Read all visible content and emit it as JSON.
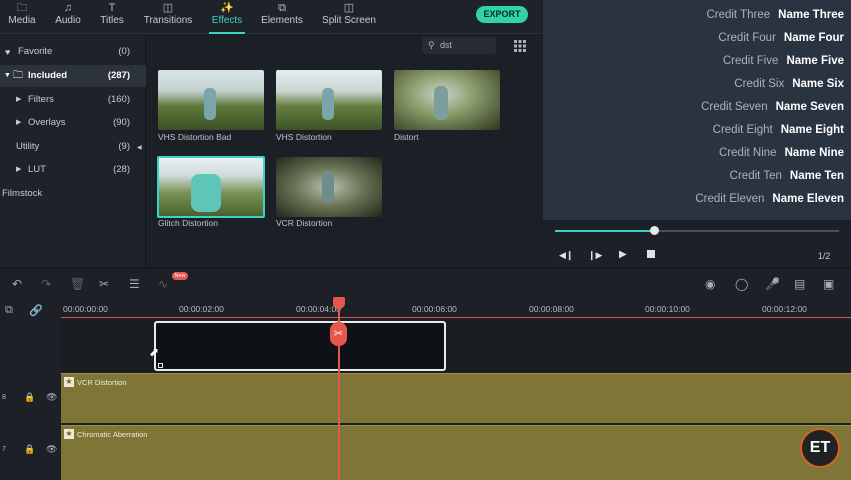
{
  "toolbar": {
    "tabs": [
      {
        "label": "Media",
        "icon": "folder-icon"
      },
      {
        "label": "Audio",
        "icon": "music-note-icon"
      },
      {
        "label": "Titles",
        "icon": "text-t-icon"
      },
      {
        "label": "Transitions",
        "icon": "transitions-icon"
      },
      {
        "label": "Effects",
        "icon": "effects-icon",
        "active": true
      },
      {
        "label": "Elements",
        "icon": "elements-icon"
      },
      {
        "label": "Split Screen",
        "icon": "split-screen-icon"
      }
    ],
    "export_label": "EXPORT",
    "accent_color": "#39d3c7"
  },
  "sidebar": {
    "items": [
      {
        "label": "Favorite",
        "count": "(0)",
        "icon": "heart-icon"
      },
      {
        "label": "Included",
        "count": "(287)",
        "icon": "folder-icon",
        "selected": true
      },
      {
        "label": "Filters",
        "count": "(160)"
      },
      {
        "label": "Overlays",
        "count": "(90)"
      },
      {
        "label": "Utility",
        "count": "(9)"
      },
      {
        "label": "LUT",
        "count": "(28)"
      },
      {
        "label": "Filmstock",
        "count": ""
      }
    ]
  },
  "search": {
    "value": "dst",
    "icon": "search-icon"
  },
  "effects": [
    {
      "label": "VHS Distortion Bad"
    },
    {
      "label": "VHS Distortion"
    },
    {
      "label": "Distort"
    },
    {
      "label": "Glitch Distortion",
      "selected": true
    },
    {
      "label": "VCR Distortion"
    }
  ],
  "preview": {
    "credits": [
      {
        "role": "Credit Three",
        "name": "Name Three"
      },
      {
        "role": "Credit Four",
        "name": "Name Four"
      },
      {
        "role": "Credit Five",
        "name": "Name Five"
      },
      {
        "role": "Credit Six",
        "name": "Name Six"
      },
      {
        "role": "Credit Seven",
        "name": "Name Seven"
      },
      {
        "role": "Credit Eight",
        "name": "Name Eight"
      },
      {
        "role": "Credit Nine",
        "name": "Name Nine"
      },
      {
        "role": "Credit Ten",
        "name": "Name Ten"
      },
      {
        "role": "Credit Eleven",
        "name": "Name Eleven"
      }
    ],
    "progress": 0.35,
    "quality": "1/2"
  },
  "timeline": {
    "ticks": [
      "00:00:00:00",
      "00:00:02:00",
      "00:00:04:00",
      "00:00:06:00",
      "00:00:08:00",
      "00:00:10:00",
      "00:00:12:00"
    ],
    "new_badge": "New",
    "tracks": [
      {
        "number": "8",
        "label": "VCR Distortion"
      },
      {
        "number": "7",
        "label": "Chromatic Aberration"
      }
    ]
  },
  "logo_text": "ET"
}
